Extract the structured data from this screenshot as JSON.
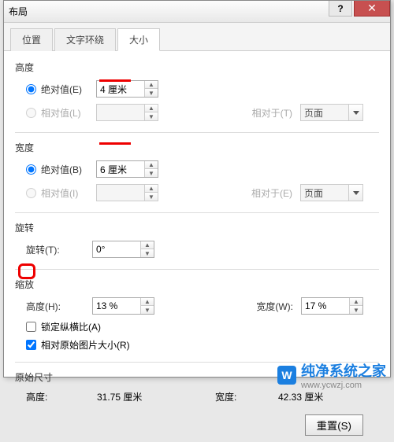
{
  "window": {
    "title": "布局"
  },
  "tabs": {
    "position": "位置",
    "wrap": "文字环绕",
    "size": "大小"
  },
  "height": {
    "title": "高度",
    "abs_label": "绝对值(E)",
    "abs_value": "4 厘米",
    "rel_label": "相对值(L)",
    "relto_label": "相对于(T)",
    "relto_value": "页面"
  },
  "width": {
    "title": "宽度",
    "abs_label": "绝对值(B)",
    "abs_value": "6 厘米",
    "rel_label": "相对值(I)",
    "relto_label": "相对于(E)",
    "relto_value": "页面"
  },
  "rotate": {
    "title": "旋转",
    "label": "旋转(T):",
    "value": "0°"
  },
  "scale": {
    "title": "缩放",
    "h_label": "高度(H):",
    "h_value": "13 %",
    "w_label": "宽度(W):",
    "w_value": "17 %",
    "lock_label": "锁定纵横比(A)",
    "relorig_label": "相对原始图片大小(R)"
  },
  "orig": {
    "title": "原始尺寸",
    "h_label": "高度:",
    "h_value": "31.75 厘米",
    "w_label": "宽度:",
    "w_value": "42.33 厘米"
  },
  "reset": "重置(S)",
  "watermark": {
    "brand": "纯净系统之家",
    "url": "www.ycwzj.com"
  }
}
